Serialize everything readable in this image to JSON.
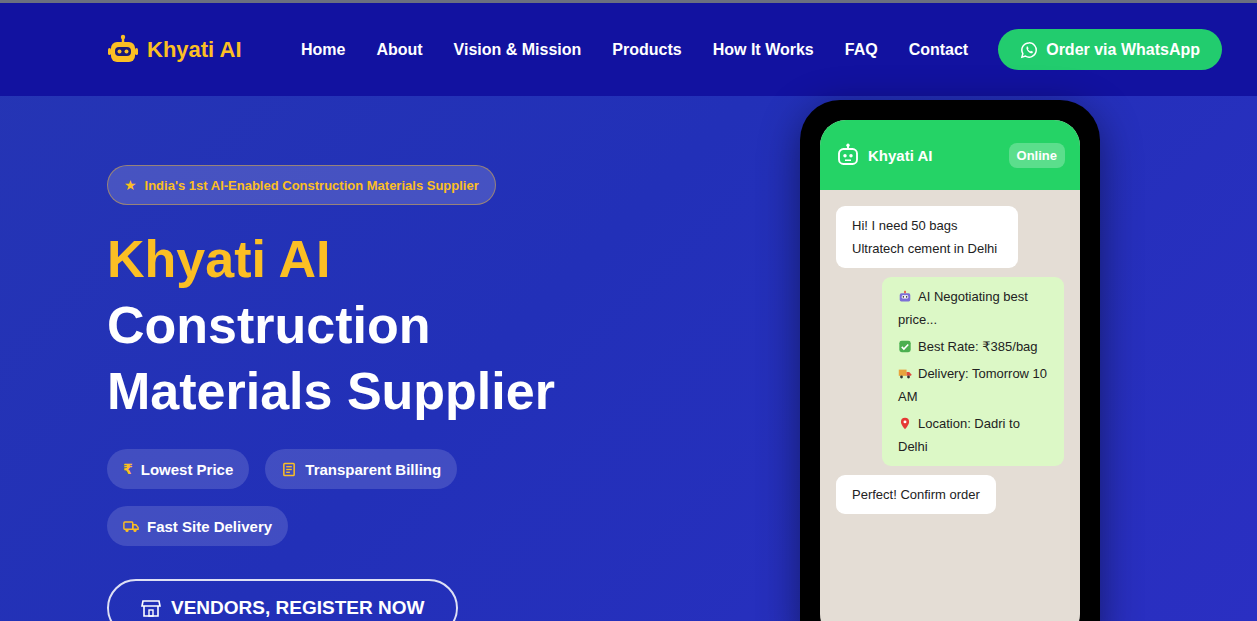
{
  "header": {
    "logo": "Khyati AI",
    "nav": [
      {
        "label": "Home",
        "selected": false
      },
      {
        "label": "About",
        "selected": false
      },
      {
        "label": "Vision & Mission",
        "selected": false
      },
      {
        "label": "Products",
        "selected": false
      },
      {
        "label": "How It Works",
        "selected": false
      },
      {
        "label": "FAQ",
        "selected": false
      },
      {
        "label": "Contact",
        "selected": false
      }
    ],
    "cta": "Order via WhatsApp"
  },
  "hero": {
    "badge": {
      "icon": "★",
      "text": "India's 1st AI-Enabled Construction Materials Supplier"
    },
    "title_accent": "Khyati AI",
    "title_lines": [
      "Construction",
      "Materials Supplier"
    ],
    "features": [
      {
        "kind": "glyph",
        "icon": "₹",
        "label": "Lowest Price"
      },
      {
        "kind": "billing",
        "label": "Transparent Billing"
      },
      {
        "kind": "delivery",
        "label": "Fast Site Delivery"
      }
    ],
    "vendor_button": "VENDORS, REGISTER NOW"
  },
  "phone": {
    "title": "Khyati AI",
    "status": "Online",
    "messages": [
      {
        "kind": "customer",
        "lines": [
          {
            "kind": "plain",
            "text": "Hi! I need 50 bags Ultratech cement in Delhi"
          }
        ]
      },
      {
        "kind": "ai",
        "lines": [
          {
            "kind": "robot",
            "text": "AI Negotiating best price..."
          },
          {
            "kind": "check",
            "text": "Best Rate: ₹385/bag"
          },
          {
            "kind": "truck",
            "text": "Delivery: Tomorrow 10 AM"
          },
          {
            "kind": "pin",
            "text": "Location: Dadri to Delhi"
          }
        ]
      },
      {
        "kind": "customer",
        "lines": [
          {
            "kind": "plain",
            "text": "Perfect! Confirm order"
          }
        ]
      }
    ]
  }
}
